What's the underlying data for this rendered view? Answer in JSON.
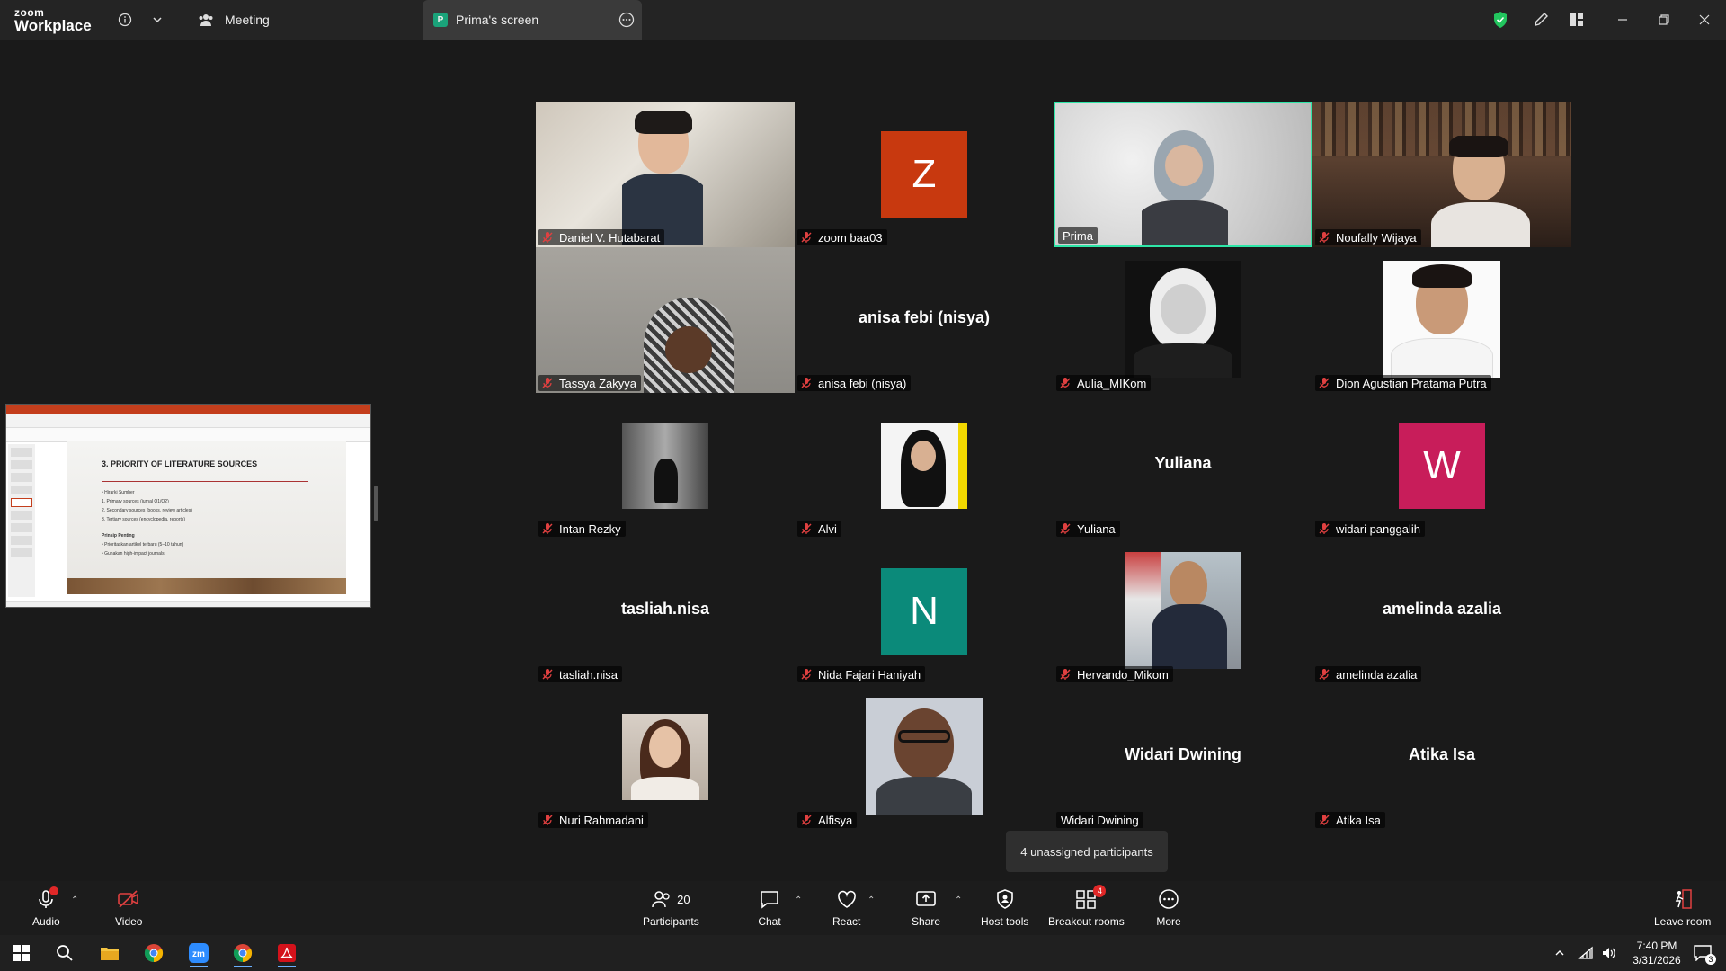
{
  "app": {
    "logo_top": "zoom",
    "logo_bottom": "Workplace"
  },
  "tabs": [
    {
      "label": "Meeting"
    },
    {
      "label": "Prima's screen",
      "badge": "P"
    }
  ],
  "colors": {
    "active_speaker": "#2ee6a8",
    "z_avatar": "#c8390f",
    "w_avatar": "#c81d5a",
    "n_avatar": "#0b8a7a"
  },
  "shared_slide": {
    "title": "3. PRIORITY OF LITERATURE SOURCES",
    "lines": [
      "• Hirarki Sumber",
      "1. Primary sources (jurnal Q1/Q2)",
      "2. Secondary sources (books, review articles)",
      "3. Tertiary sources (encyclopedia, reports)",
      "Prinsip Penting",
      "• Prioritaskan artikel terbaru (5–10 tahun)",
      "• Gunakan high-impact journals"
    ]
  },
  "participants": [
    {
      "name": "Daniel V. Hutabarat",
      "kind": "video"
    },
    {
      "name": "zoom baa03",
      "kind": "letter",
      "letter": "Z"
    },
    {
      "name": "Prima",
      "kind": "video",
      "active": true
    },
    {
      "name": "Noufally Wijaya",
      "kind": "video"
    },
    {
      "name": "Tassya Zakyya",
      "kind": "video"
    },
    {
      "name": "anisa febi (nisya)",
      "kind": "text"
    },
    {
      "name": "Aulia_MIKom",
      "kind": "photo"
    },
    {
      "name": "Dion Agustian Pratama Putra",
      "kind": "photo"
    },
    {
      "name": "Intan Rezky",
      "kind": "photo"
    },
    {
      "name": "Alvi",
      "kind": "photo"
    },
    {
      "name": "Yuliana",
      "kind": "text"
    },
    {
      "name": "widari panggalih",
      "kind": "letter",
      "letter": "W"
    },
    {
      "name": "tasliah.nisa",
      "kind": "text"
    },
    {
      "name": "Nida Fajari Haniyah",
      "kind": "letter",
      "letter": "N"
    },
    {
      "name": "Hervando_Mikom",
      "kind": "photo"
    },
    {
      "name": "amelinda azalia",
      "kind": "text"
    },
    {
      "name": "Nuri Rahmadani",
      "kind": "photo"
    },
    {
      "name": "Alfisya",
      "kind": "photo"
    },
    {
      "name": "Widari Dwining",
      "kind": "text"
    },
    {
      "name": "Atika Isa",
      "kind": "text"
    }
  ],
  "tooltip": "4 unassigned participants",
  "toolbar": {
    "audio": "Audio",
    "video": "Video",
    "participants": "Participants",
    "participants_count": "20",
    "chat": "Chat",
    "react": "React",
    "share": "Share",
    "host_tools": "Host tools",
    "breakout": "Breakout rooms",
    "breakout_badge": "4",
    "more": "More",
    "leave": "Leave room"
  },
  "taskbar": {
    "time": "7:40 PM",
    "date": "3/31/2026",
    "notifications": "3"
  }
}
